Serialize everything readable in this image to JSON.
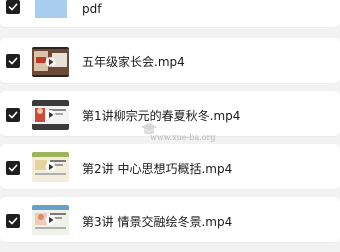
{
  "files": [
    {
      "name": "pdf",
      "type": "folder",
      "checked": true
    },
    {
      "name": "五年级家长会.mp4",
      "type": "video",
      "checked": true
    },
    {
      "name": "第1讲柳宗元的春夏秋冬.mp4",
      "type": "video",
      "checked": true
    },
    {
      "name": "第2讲 中心思想巧概括.mp4",
      "type": "video",
      "checked": true
    },
    {
      "name": "第3讲 情景交融绘冬景.mp4",
      "type": "video",
      "checked": true
    }
  ],
  "watermark": {
    "text": "www.xue-ba.org"
  }
}
